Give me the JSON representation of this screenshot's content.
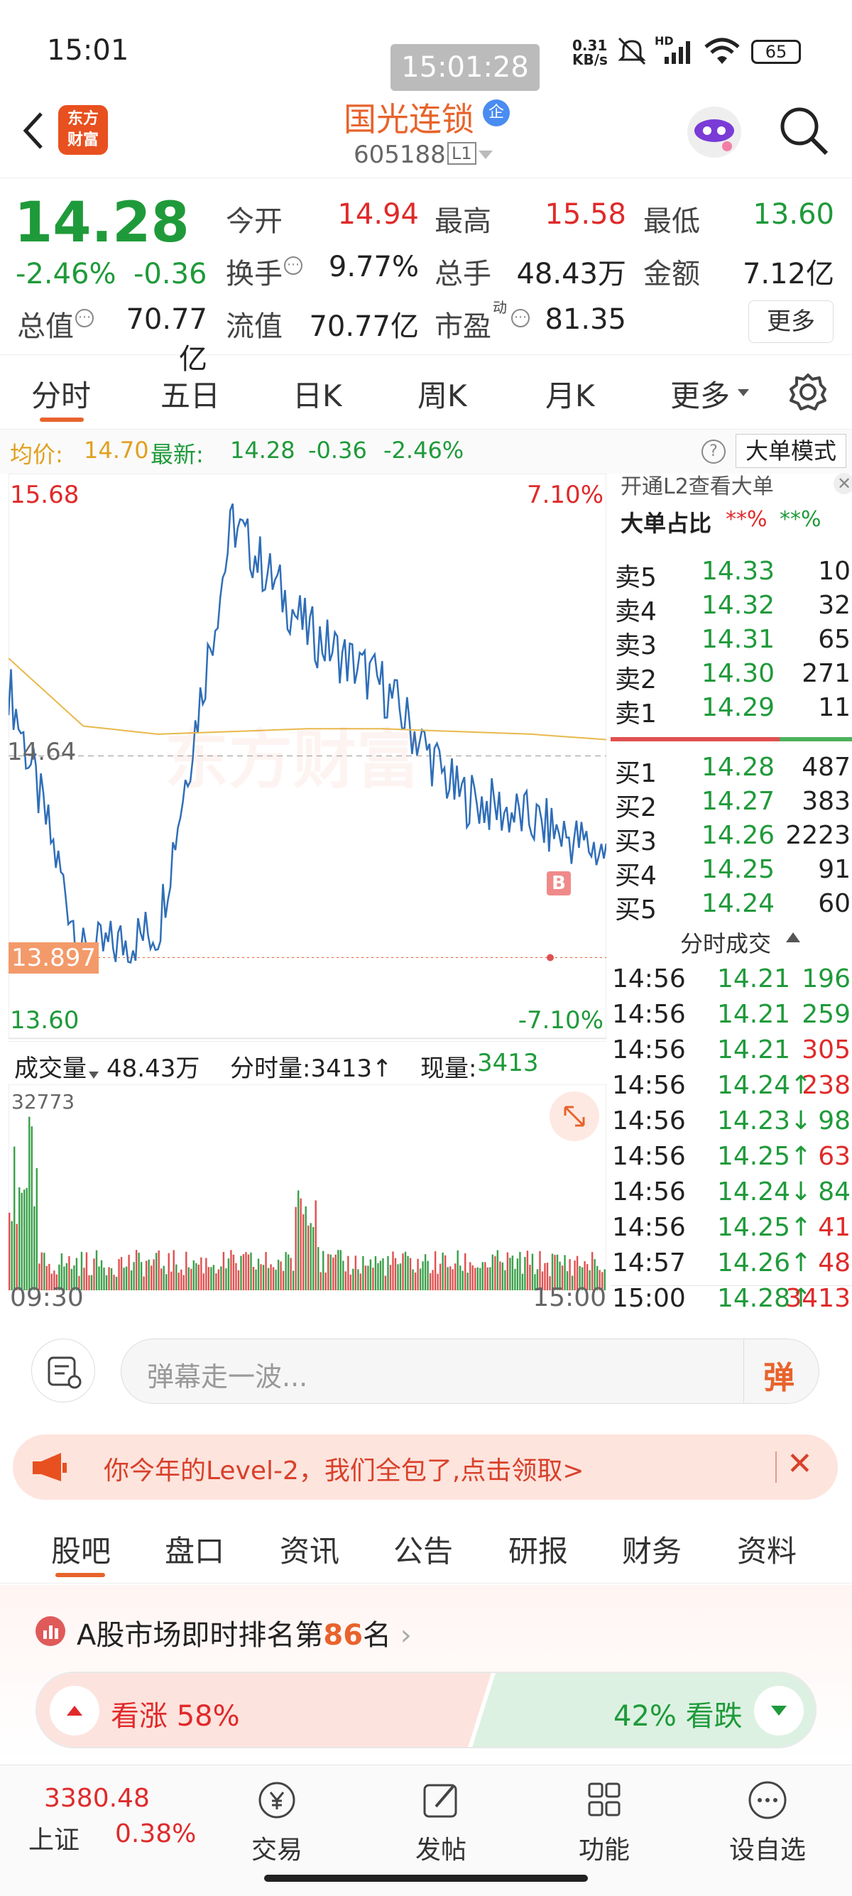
{
  "status": {
    "time": "15:01",
    "speed_top": "0.31",
    "speed_bottom": "KB/s",
    "battery": "65",
    "overlay_time": "15:01:28",
    "hd": "HD"
  },
  "header": {
    "logo_line1": "东方",
    "logo_line2": "财富",
    "title": "国光连锁",
    "badge": "企",
    "code": "605188",
    "level": "L1"
  },
  "quote": {
    "price": "14.28",
    "change_pct": "-2.46%",
    "change": "-0.36",
    "open_label": "今开",
    "open": "14.94",
    "high_label": "最高",
    "high": "15.58",
    "low_label": "最低",
    "low": "13.60",
    "turnover_label": "换手",
    "turnover": "9.77%",
    "volume_label": "总手",
    "volume": "48.43万",
    "amount_label": "金额",
    "amount": "7.12亿",
    "mktcap_label": "总值",
    "mktcap": "70.77亿",
    "float_label": "流值",
    "float": "70.77亿",
    "pe_label": "市盈",
    "pe_sup": "动",
    "pe": "81.35",
    "more": "更多"
  },
  "tabs": [
    "分时",
    "五日",
    "日K",
    "周K",
    "月K",
    "更多"
  ],
  "infoline": {
    "avg_label": "均价:",
    "avg": "14.70",
    "latest_label": "最新:",
    "latest": "14.28",
    "chg": "-0.36",
    "pct": "-2.46%",
    "mode": "大单模式"
  },
  "chart": {
    "high": "15.68",
    "low": "13.60",
    "pct_high": "7.10%",
    "pct_low": "-7.10%",
    "pre_close": "14.64",
    "marker": "13.897",
    "b_marker": "B",
    "watermark": "东方财富",
    "vol_label": "成交量",
    "vol_total": "48.43万",
    "tick_vol_label": "分时量:3413↑",
    "now_label": "现量:",
    "now": "3413",
    "vol_max": "32773",
    "t_start": "09:30",
    "t_end": "15:00"
  },
  "orderbook": {
    "l2_hint": "开通L2查看大单",
    "big_ratio_label": "大单占比",
    "big_ratio_a": "**%",
    "big_ratio_b": "**%",
    "asks": [
      {
        "label": "卖5",
        "price": "14.33",
        "vol": "10"
      },
      {
        "label": "卖4",
        "price": "14.32",
        "vol": "32"
      },
      {
        "label": "卖3",
        "price": "14.31",
        "vol": "65"
      },
      {
        "label": "卖2",
        "price": "14.30",
        "vol": "271"
      },
      {
        "label": "卖1",
        "price": "14.29",
        "vol": "11"
      }
    ],
    "bids": [
      {
        "label": "买1",
        "price": "14.28",
        "vol": "487"
      },
      {
        "label": "买2",
        "price": "14.27",
        "vol": "383"
      },
      {
        "label": "买3",
        "price": "14.26",
        "vol": "2223"
      },
      {
        "label": "买4",
        "price": "14.25",
        "vol": "91"
      },
      {
        "label": "买5",
        "price": "14.24",
        "vol": "60"
      }
    ],
    "trades_label": "分时成交",
    "trades": [
      {
        "t": "14:56",
        "p": "14.21",
        "v": "196",
        "vc": "green"
      },
      {
        "t": "14:56",
        "p": "14.21",
        "v": "259",
        "vc": "green"
      },
      {
        "t": "14:56",
        "p": "14.21",
        "v": "305",
        "vc": "red"
      },
      {
        "t": "14:56",
        "p": "14.24↑",
        "v": "238",
        "vc": "red"
      },
      {
        "t": "14:56",
        "p": "14.23↓",
        "v": "98",
        "vc": "green"
      },
      {
        "t": "14:56",
        "p": "14.25↑",
        "v": "63",
        "vc": "red"
      },
      {
        "t": "14:56",
        "p": "14.24↓",
        "v": "84",
        "vc": "green"
      },
      {
        "t": "14:56",
        "p": "14.25↑",
        "v": "41",
        "vc": "red"
      },
      {
        "t": "14:57",
        "p": "14.26↑",
        "v": "48",
        "vc": "red"
      },
      {
        "t": "15:00",
        "p": "14.28↑",
        "v": "3413",
        "vc": "red"
      }
    ]
  },
  "comment": {
    "placeholder": "弹幕走一波...",
    "send": "弹"
  },
  "banner": {
    "text": "你今年的Level-2，我们全包了,点击领取>"
  },
  "subtabs": [
    "股吧",
    "盘口",
    "资讯",
    "公告",
    "研报",
    "财务",
    "资料"
  ],
  "rank": {
    "prefix": "A股市场即时排名第",
    "num": "86",
    "suffix": "名",
    "up": "看涨 58%",
    "down": "42% 看跌"
  },
  "bottomnav": {
    "index_value": "3380.48",
    "index_name": "上证",
    "index_pct": "0.38%",
    "items": [
      "交易",
      "发帖",
      "功能",
      "设自选"
    ]
  },
  "chart_data": {
    "type": "line",
    "title": "",
    "ylim": [
      13.6,
      15.68
    ],
    "pre_close": 14.64,
    "series": [
      {
        "name": "最新",
        "x": [
          "09:30",
          "10:00",
          "10:30",
          "11:00",
          "11:30",
          "13:30",
          "14:00",
          "14:30",
          "15:00"
        ],
        "values": [
          14.9,
          13.9,
          14.0,
          15.5,
          15.1,
          14.9,
          14.5,
          14.4,
          14.28
        ]
      },
      {
        "name": "均价",
        "x": [
          "09:30",
          "10:00",
          "10:30",
          "11:00",
          "11:30",
          "13:30",
          "14:00",
          "14:30",
          "15:00"
        ],
        "values": [
          15.0,
          14.75,
          14.72,
          14.73,
          14.74,
          14.74,
          14.73,
          14.72,
          14.7
        ]
      }
    ]
  }
}
